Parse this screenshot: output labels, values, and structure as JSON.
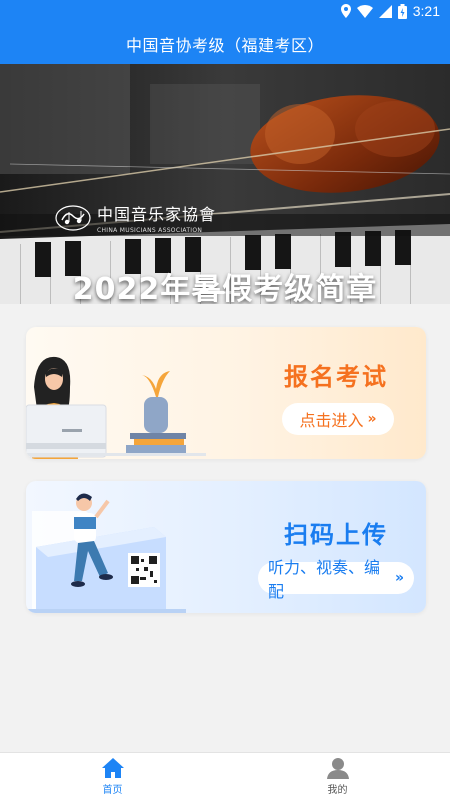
{
  "status_bar": {
    "time": "3:21",
    "icons": [
      "location-icon",
      "wifi-icon",
      "signal-icon",
      "battery-icon"
    ]
  },
  "app_bar": {
    "title": "中国音协考级（福建考区）"
  },
  "banner": {
    "logo_cn": "中国音乐家協會",
    "logo_en": "CHINA MUSICIANS ASSOCIATION",
    "headline": "2022年暑假考级简章",
    "slide_index": 1,
    "slide_count": 2
  },
  "cards": {
    "signup": {
      "title": "报名考试",
      "button": "点击进入",
      "accent": "#f5711f"
    },
    "scan": {
      "title": "扫码上传",
      "button": "听力、视奏、编配",
      "accent": "#1a7df0"
    }
  },
  "bottom_nav": {
    "home": "首页",
    "mine": "我的",
    "active_color": "#1d84f5"
  },
  "colors": {
    "primary": "#1d84f5"
  }
}
